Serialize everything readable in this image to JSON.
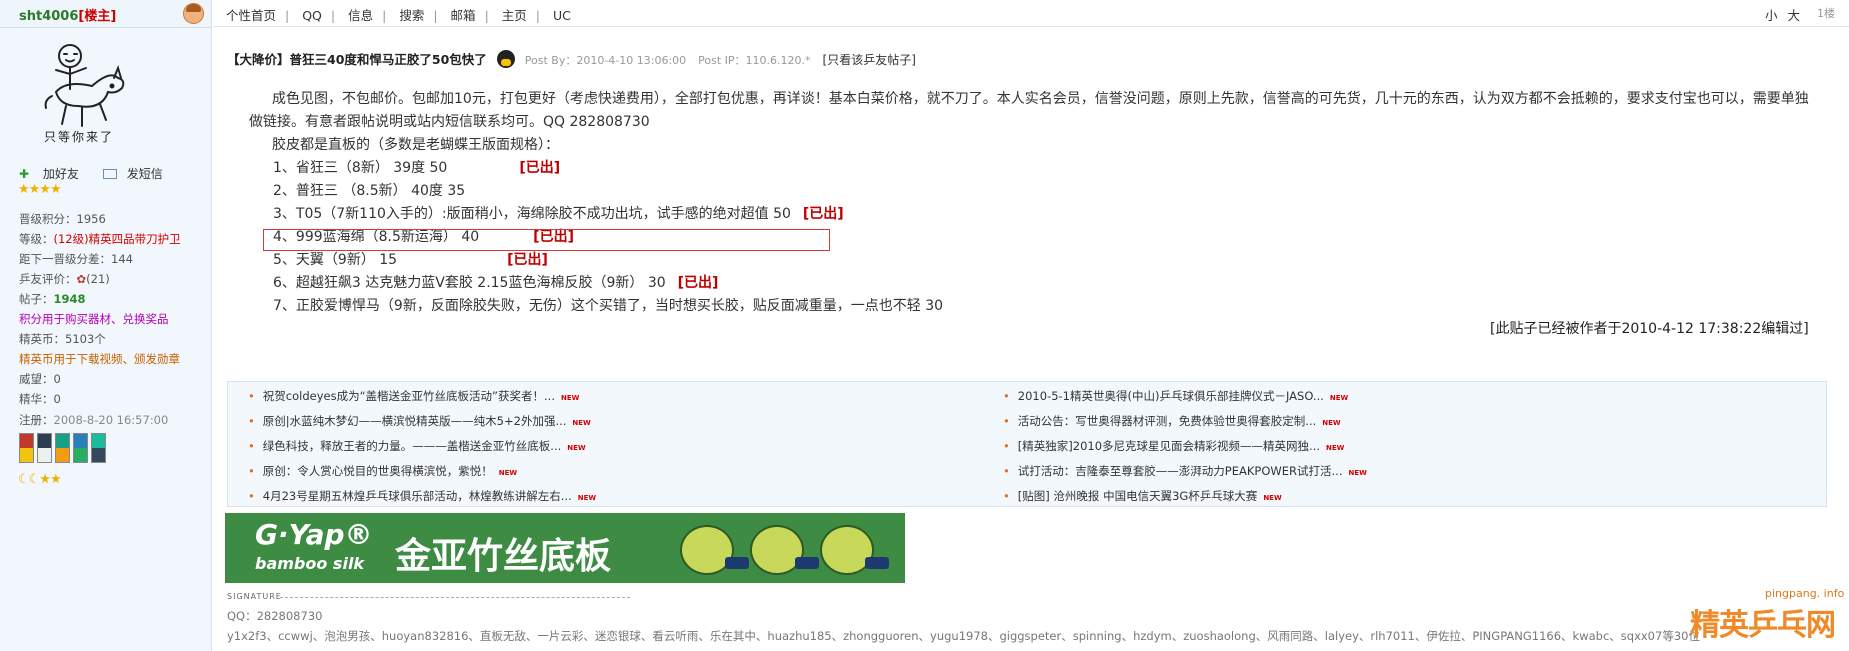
{
  "sidebar": {
    "username": "sht4006",
    "role": "[楼主]",
    "signature_caption": "只等你来了",
    "actions": {
      "add_friend": "加好友",
      "send_message": "发短信"
    },
    "stars_top": "★★★★",
    "stats": [
      {
        "label": "晋级积分：",
        "value": "1956"
      },
      {
        "label": "等级：",
        "value": "(12级)精英四品带刀护卫"
      },
      {
        "label": "距下一晋级分差：",
        "value": "144"
      },
      {
        "label": "乒友评价：",
        "value": "(21)"
      },
      {
        "label": "帖子：",
        "value": "1948"
      },
      {
        "label": "",
        "value": "积分用于购买器材、兑换奖品"
      },
      {
        "label": "精英币：",
        "value": "5103个"
      },
      {
        "label": "",
        "value": "精英币用于下载视频、颁发勋章"
      },
      {
        "label": "威望：",
        "value": "0"
      },
      {
        "label": "精华：",
        "value": "0"
      },
      {
        "label": "注册：",
        "value": "2008-8-20 16:57:00"
      }
    ],
    "stars_bottom": "☾☾★★"
  },
  "topnav": {
    "items": [
      "个性首页",
      "QQ",
      "信息",
      "搜索",
      "邮箱",
      "主页",
      "UC"
    ],
    "font_small": "小",
    "font_large": "大",
    "floor": "1楼"
  },
  "post": {
    "title": "【大降价】普狂三40度和悍马正胶了50包快了",
    "post_by": "Post By：2010-4-10 13:06:00",
    "post_ip": "Post IP：110.6.120.*",
    "only_author": "[只看该乒友帖子]",
    "intro": "成色见图，不包邮价。包邮加10元，打包更好（考虑快递费用），全部打包优惠，再详谈！基本白菜价格，就不刀了。本人实名会员，信誉没问题，原则上先款，信誉高的可先货，几十元的东西，认为双方都不会抵赖的，要求支付宝也可以，需要单独做链接。有意者跟帖说明或站内短信联系均可。QQ 282808730",
    "note": "胶皮都是直板的（多数是老蝴蝶王版面规格）：",
    "items": [
      {
        "text": "1、省狂三（8新） 39度 50",
        "status": "[已出]"
      },
      {
        "text": "2、普狂三 （8.5新） 40度 35",
        "status": ""
      },
      {
        "text": "3、T05（7新110入手的）:版面稍小，海绵除胶不成功出坑，试手感的绝对超值 50",
        "status": "[已出]"
      },
      {
        "text": "4、999蓝海绵（8.5新运海） 40",
        "status": "[已出]"
      },
      {
        "text": "5、天翼（9新） 15",
        "status": "[已出]"
      },
      {
        "text": "6、超越狂飙3 达克魅力蓝V套胶 2.15蓝色海棉反胶（9新） 30",
        "status": "[已出]"
      },
      {
        "text": "7、正胶爱博悍马（9新，反面除胶失败，无伤）这个买错了，当时想买长胶，贴反面减重量，一点也不轻 30",
        "status": ""
      }
    ],
    "edit_note": "[此贴子已经被作者于2010-4-12 17:38:22编辑过]"
  },
  "related": {
    "left": [
      "祝贺coldeyes成为“盖楷送金亚竹丝底板活动”获奖者！...",
      "原创|水蓝纯木梦幻——横滨悦精英版——纯木5+2外加强...",
      "绿色科技，释放王者的力量。———盖楷送金亚竹丝底板...",
      "原创：令人赏心悦目的世奥得横滨悦，紫悦！",
      "4月23号星期五林煌乒乓球俱乐部活动，林煌教练讲解左右..."
    ],
    "right": [
      "2010-5-1精英世奥得(中山)乒乓球俱乐部挂牌仪式－JASO...",
      "活动公告：写世奥得器材评测，免费体验世奥得套胶定制...",
      "[精英独家]2010多尼克球星见面会精彩视频——精英网独...",
      "试打活动：吉隆泰至尊套胶——澎湃动力PEAKPOWER试打活...",
      "[贴图] 沧州晚报 中国电信天翼3G杯乒乓球大赛"
    ],
    "new_badge": "NEW"
  },
  "banner": {
    "brand": "G·Yap®",
    "sub": "bamboo silk",
    "main": "金亚竹丝底板"
  },
  "signature": {
    "label": "SIGNATURE",
    "qq": "QQ：282808730",
    "thanks": "y1x2f3、ccwwj、泡泡男孩、huoyan832816、直板无敌、一片云彩、迷恋银球、看云听雨、乐在其中、huazhu185、zhongguoren、yugu1978、giggspeter、spinning、hzdym、zuoshaolong、风雨同路、lalyey、rlh7011、伊佐拉、PINGPANG1166、kwabc、sqxx07等30位"
  },
  "watermark": {
    "url": "pingpang. info",
    "logo": "精英乒乓网"
  }
}
